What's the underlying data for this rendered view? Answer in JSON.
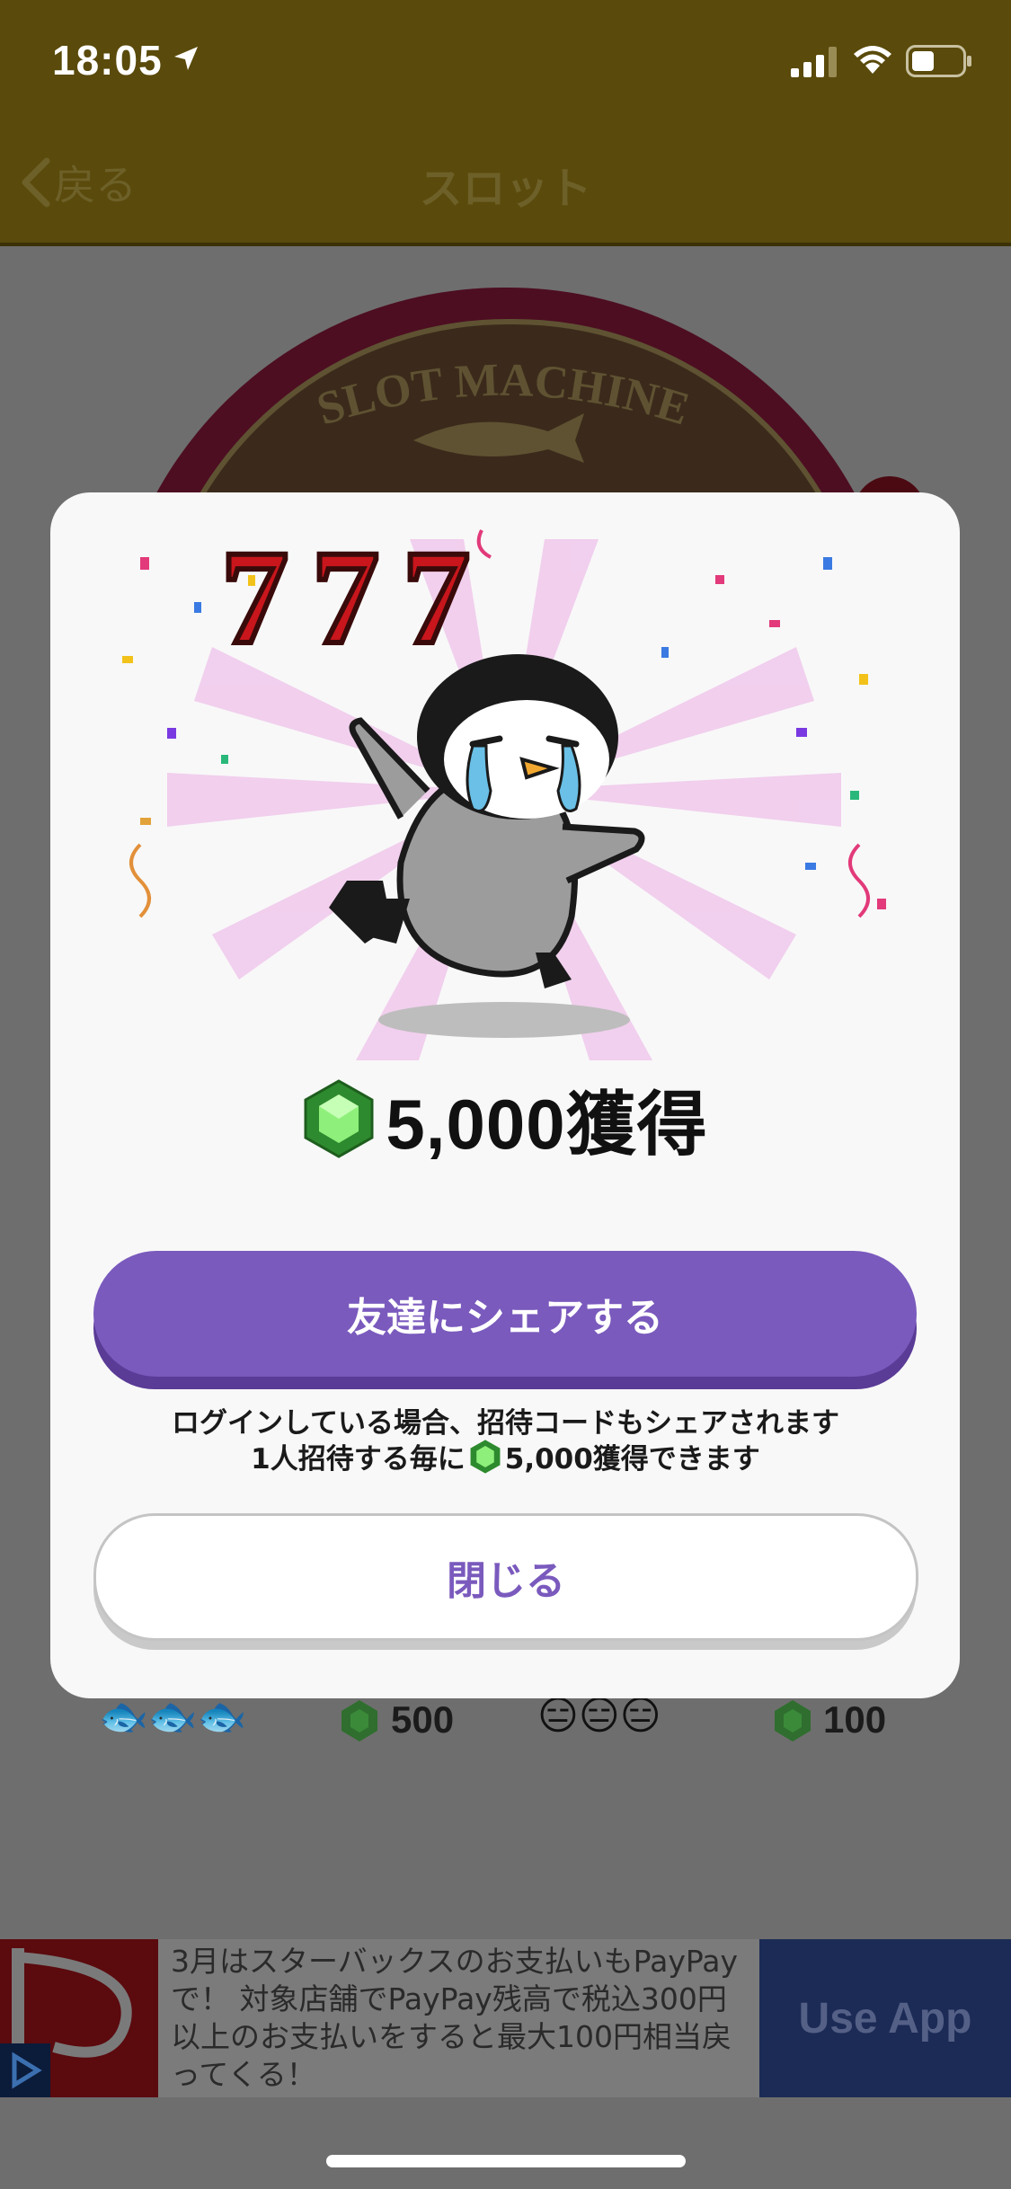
{
  "status_bar": {
    "time": "18:05"
  },
  "nav": {
    "back_label": "戻る",
    "title": "スロット"
  },
  "background": {
    "machine_title": "SLOT MACHINE",
    "payouts": [
      {
        "symbol": "fish",
        "amount": "500"
      },
      {
        "symbol": "penguin",
        "amount": "100"
      }
    ]
  },
  "dialog": {
    "jackpot_text": "777",
    "reward_text": "5,000獲得",
    "share_label": "友達にシェアする",
    "note_line1": "ログインしている場合、招待コードもシェアされます",
    "note_line2_before": "1人招待する毎に",
    "note_line2_after": "5,000獲得できます",
    "close_label": "閉じる"
  },
  "ad": {
    "text": "3月はスターバックスのお支払いもPayPayで！ 対象店舗でPayPay残高で税込300円以上のお支払いをすると最大100円相当戻ってくる！",
    "button_label": "Use App"
  },
  "colors": {
    "accent": "#7a5abd",
    "nav_bg": "#5a4a0b",
    "gem": "#3fbf3f"
  }
}
